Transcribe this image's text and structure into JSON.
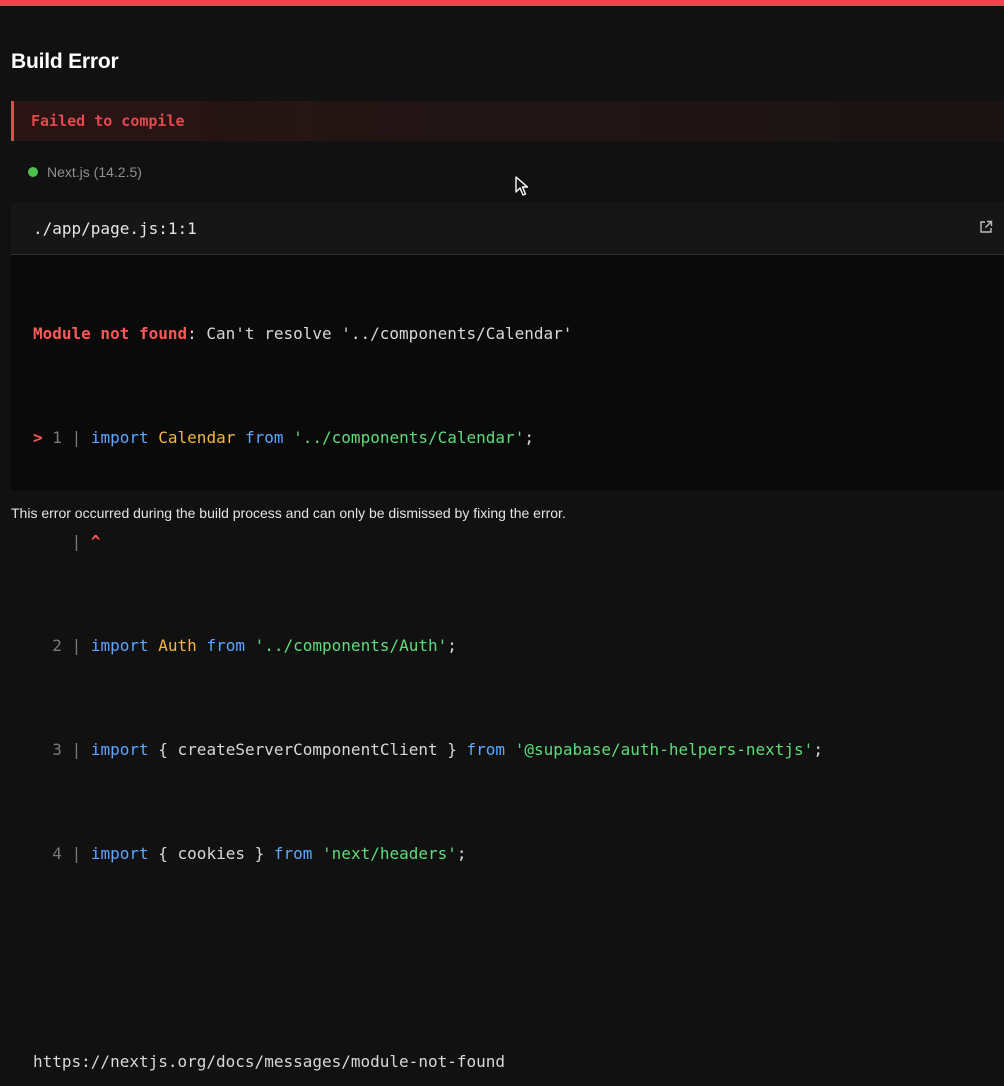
{
  "page": {
    "title": "Build Error",
    "fail_label": "Failed to compile",
    "version": "Next.js (14.2.5)",
    "footer": "This error occurred during the build process and can only be dismissed by fixing the error."
  },
  "colors": {
    "accent": "#e5484d",
    "status_dot": "#4cc24f"
  },
  "icons": {
    "status": "status-dot-icon",
    "open_editor": "external-link-icon",
    "pointer": "mouse-cursor-icon"
  },
  "code_frame": {
    "file_path": "./app/page.js:1:1",
    "error_label": "Module not found",
    "error_message": ": Can't resolve '../components/Calendar'",
    "lines": [
      {
        "marker": ">",
        "num": "1",
        "sep": "|",
        "kw1": "import",
        "ident": " Calendar ",
        "kw2": "from",
        "str": " '../components/Calendar'",
        "tail": ";"
      },
      {
        "marker": " ",
        "num": " ",
        "sep": "|",
        "caret": " ^"
      },
      {
        "marker": " ",
        "num": "2",
        "sep": "|",
        "kw1": "import",
        "ident": " Auth ",
        "kw2": "from",
        "str": " '../components/Auth'",
        "tail": ";"
      },
      {
        "marker": " ",
        "num": "3",
        "sep": "|",
        "kw1": "import",
        "plain": " { createServerComponentClient } ",
        "kw2": "from",
        "str": " '@supabase/auth-helpers-nextjs'",
        "tail": ";"
      },
      {
        "marker": " ",
        "num": "4",
        "sep": "|",
        "kw1": "import",
        "plain": " { cookies } ",
        "kw2": "from",
        "str": " 'next/headers'",
        "tail": ";"
      }
    ],
    "doc_link": "https://nextjs.org/docs/messages/module-not-found"
  }
}
